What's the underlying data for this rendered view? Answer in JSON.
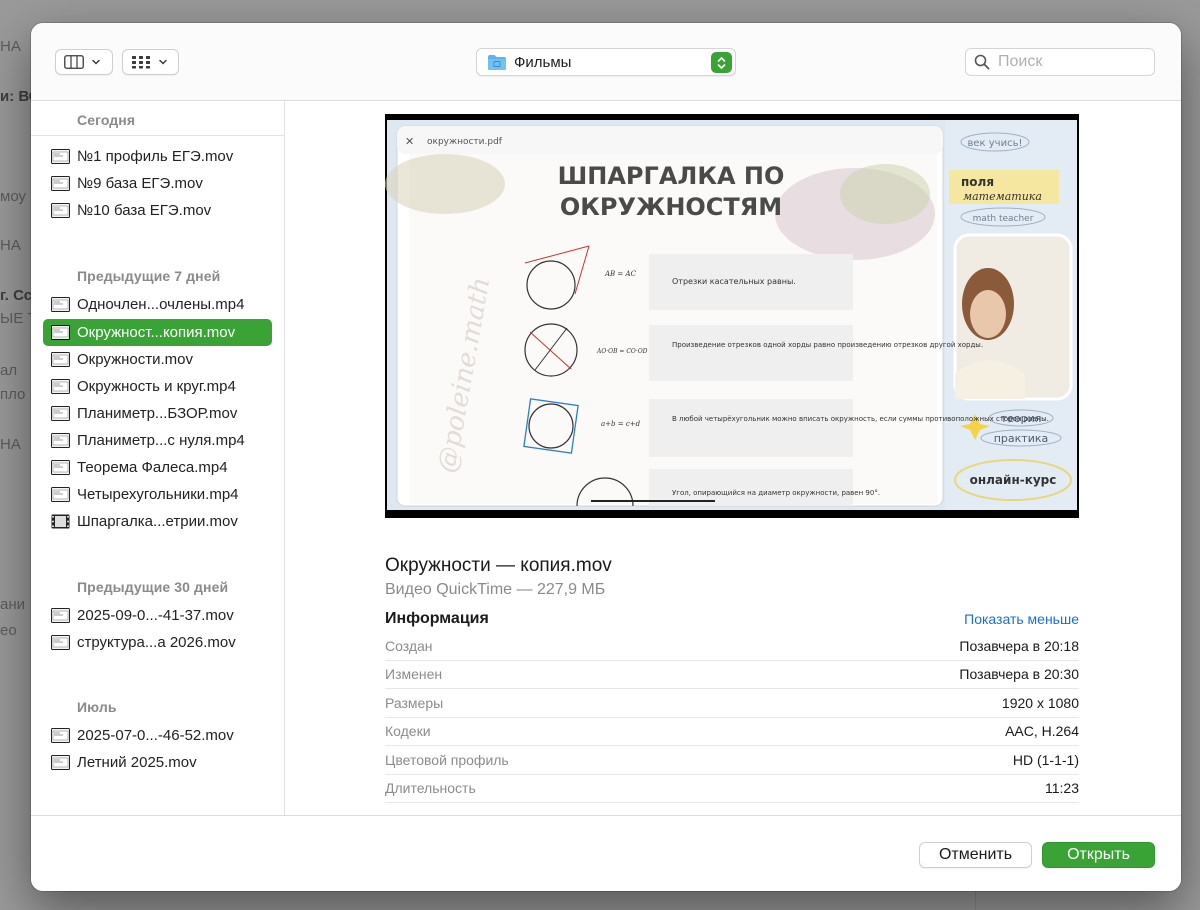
{
  "background": {
    "fragments": [
      "НА",
      "и: ВС",
      "моу",
      "НА",
      "г. Сс",
      "ЫЕ Т",
      "ал",
      "пло",
      "НА",
      "ани",
      "ео"
    ]
  },
  "toolbar": {
    "view_icon": "columns-view-icon",
    "group_icon": "gallery-grid-icon",
    "location": "Фильмы",
    "location_icon": "folder-icon",
    "search_placeholder": "Поиск",
    "search_value": ""
  },
  "sidebar": {
    "sections": [
      {
        "title": "Сегодня",
        "items": [
          {
            "label": "№1 профиль ЕГЭ.mov",
            "selected": false
          },
          {
            "label": "№9 база ЕГЭ.mov",
            "selected": false
          },
          {
            "label": "№10 база ЕГЭ.mov",
            "selected": false
          }
        ]
      },
      {
        "title": "Предыдущие 7 дней",
        "items": [
          {
            "label": "Одночлен...очлены.mp4",
            "selected": false
          },
          {
            "label": "Окружност...копия.mov",
            "selected": true
          },
          {
            "label": "Окружности.mov",
            "selected": false
          },
          {
            "label": "Окружность и круг.mp4",
            "selected": false
          },
          {
            "label": "Планиметр...БЗОР.mov",
            "selected": false
          },
          {
            "label": "Планиметр...с нуля.mp4",
            "selected": false
          },
          {
            "label": "Теорема Фалеса.mp4",
            "selected": false
          },
          {
            "label": "Четырехугольники.mp4",
            "selected": false
          },
          {
            "label": "Шпаргалка...етрии.mov",
            "selected": false
          }
        ]
      },
      {
        "title": "Предыдущие 30 дней",
        "items": [
          {
            "label": "2025-09-0...-41-37.mov",
            "selected": false
          },
          {
            "label": "структура...а 2026.mov",
            "selected": false
          }
        ]
      },
      {
        "title": "Июль",
        "items": [
          {
            "label": "2025-07-0...-46-52.mov",
            "selected": false
          },
          {
            "label": "Летний 2025.mov",
            "selected": false
          }
        ]
      }
    ]
  },
  "preview": {
    "thumbnail": {
      "pdf_tab": "окружности.pdf",
      "slide_title_1": "ШПАРГАЛКА ПО",
      "slide_title_2": "ОКРУЖНОСТЯМ",
      "watermark": "@poleine.math",
      "facts": [
        "Отрезки касательных равны.",
        "Произведение отрезков одной хорды равно произведению отрезков другой хорды.",
        "В любой четырёхугольник можно вписать окружность, если суммы противоположных сторон равны.",
        "Угол, опирающийся на диаметр окружности, равен 90°."
      ],
      "formulas": [
        "AB = AC",
        "AO·OB = CO·OD",
        "a+b = c+d"
      ],
      "side_tags": [
        "век учись!",
        "поля",
        "математика",
        "math teacher",
        "теория",
        "практика",
        "онлайн-курс"
      ]
    },
    "title": "Окружности — копия.mov",
    "kind": "Видео QuickTime — 227,9 МБ",
    "info_heading": "Информация",
    "show_less": "Показать меньше",
    "info": [
      {
        "key": "Создан",
        "value": "Позавчера в 20:18"
      },
      {
        "key": "Изменен",
        "value": "Позавчера в 20:30"
      },
      {
        "key": "Размеры",
        "value": "1920 x 1080"
      },
      {
        "key": "Кодеки",
        "value": "AAC, H.264"
      },
      {
        "key": "Цветовой профиль",
        "value": "HD (1-1-1)"
      },
      {
        "key": "Длительность",
        "value": "11:23"
      }
    ]
  },
  "footer": {
    "cancel_label": "Отменить",
    "open_label": "Открыть"
  },
  "colors": {
    "accent": "#3aa336",
    "link": "#1a6fd3",
    "overlay": "#9a9a9a"
  }
}
